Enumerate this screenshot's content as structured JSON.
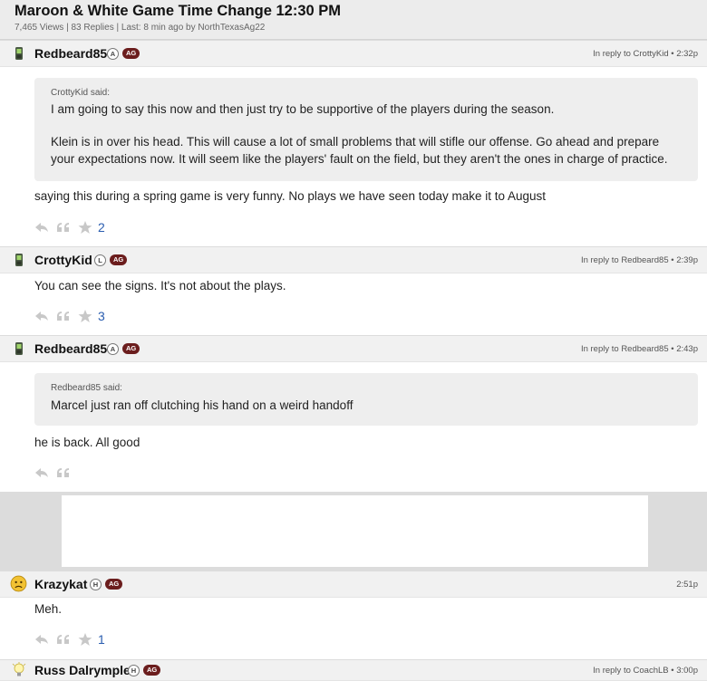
{
  "thread": {
    "title": "Maroon & White Game Time Change 12:30 PM",
    "views": "7,465 Views",
    "replies": "83 Replies",
    "last": "Last: 8 min ago by",
    "last_user": "NorthTexasAg22",
    "sep": "|"
  },
  "posts": [
    {
      "username": "Redbeard85",
      "badge_letter": "A",
      "badge_ag": "AG",
      "reply_prefix": "In reply to",
      "reply_to": "CrottyKid",
      "time": "• 2:32p",
      "quote_author": "CrottyKid said:",
      "quote_line1": "I am going to say this now and then just try to be supportive of the players during the season.",
      "quote_line2": "Klein is in over his head. This will cause a lot of small problems that will stifle our offense. Go ahead and prepare your expectations now. It will seem like the players' fault on the field, but they aren't the ones in charge of practice.",
      "body": "saying this during a spring game is very funny. No plays we have seen today make it to August",
      "stars": "2"
    },
    {
      "username": "CrottyKid",
      "badge_letter": "L",
      "badge_ag": "AG",
      "reply_prefix": "In reply to",
      "reply_to": "Redbeard85",
      "time": "• 2:39p",
      "body": "You can see the signs. It's not about the plays.",
      "stars": "3"
    },
    {
      "username": "Redbeard85",
      "badge_letter": "A",
      "badge_ag": "AG",
      "reply_prefix": "In reply to",
      "reply_to": "Redbeard85",
      "time": "• 2:43p",
      "quote_author": "Redbeard85 said:",
      "quote_line1": "Marcel just ran off clutching his hand on a weird handoff",
      "body": "he is back. All good"
    },
    {
      "username": "Krazykat",
      "badge_letter": "H",
      "badge_ag": "AG",
      "time": "2:51p",
      "body": "Meh.",
      "stars": "1"
    },
    {
      "username": "Russ Dalrymple",
      "badge_letter": "H",
      "badge_ag": "AG",
      "reply_prefix": "In reply to",
      "reply_to": "CoachLB",
      "time": "• 3:00p"
    }
  ],
  "icons": {
    "phone": "phone-icon",
    "face": "sad-face-icon",
    "bulb": "lightbulb-icon",
    "reply": "reply-icon",
    "quote": "quote-icon",
    "star": "star-icon"
  },
  "colors": {
    "ag_badge": "#6b1d1d",
    "star_count": "#2a5db0",
    "header_bg": "#f1f1f1",
    "quote_bg": "#eeeeee"
  }
}
